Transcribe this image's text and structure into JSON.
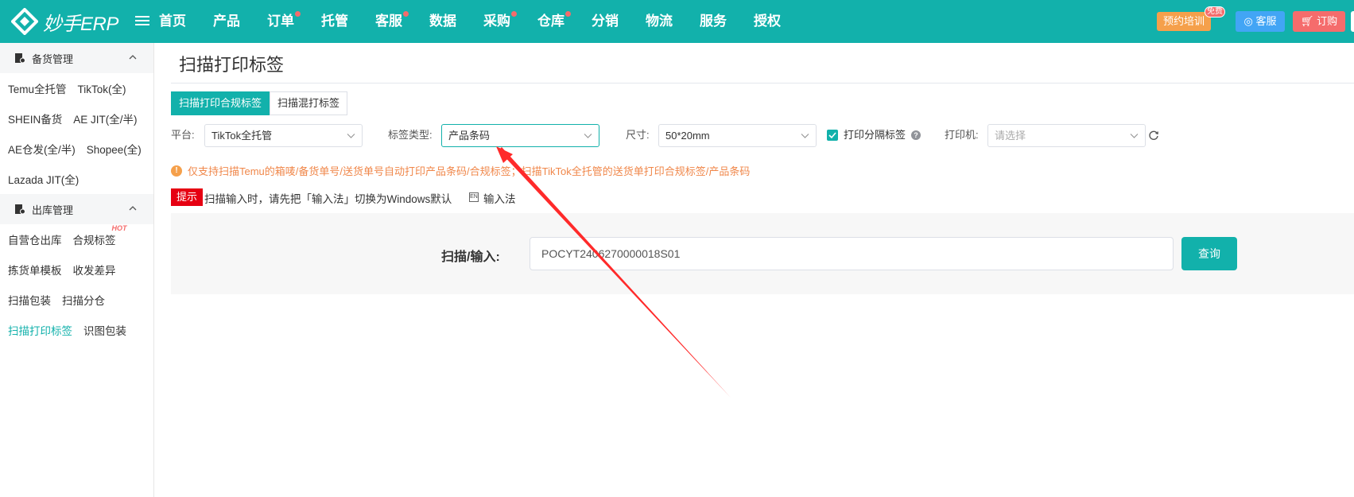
{
  "brand": {
    "logo_text": "妙手ERP",
    "color": "#12b1ab"
  },
  "nav": {
    "items": [
      {
        "label": "首页",
        "dot": false
      },
      {
        "label": "产品",
        "dot": false
      },
      {
        "label": "订单",
        "dot": true
      },
      {
        "label": "托管",
        "dot": false
      },
      {
        "label": "客服",
        "dot": true
      },
      {
        "label": "数据",
        "dot": false
      },
      {
        "label": "采购",
        "dot": true
      },
      {
        "label": "仓库",
        "dot": true
      },
      {
        "label": "分销",
        "dot": false
      },
      {
        "label": "物流",
        "dot": false
      },
      {
        "label": "服务",
        "dot": false
      },
      {
        "label": "授权",
        "dot": false
      }
    ],
    "training_label": "预约培训",
    "free_badge": "免费",
    "service_label": "客服",
    "order_label": "订购"
  },
  "sidebar": {
    "group1": {
      "label": "备货管理"
    },
    "group1_rows": [
      [
        "Temu全托管",
        "TikTok(全)"
      ],
      [
        "SHEIN备货",
        "AE JIT(全/半)"
      ],
      [
        "AE仓发(全/半)",
        "Shopee(全)"
      ],
      [
        "Lazada JIT(全)"
      ]
    ],
    "group2": {
      "label": "出库管理"
    },
    "group2_rows": [
      [
        "自营仓出库",
        "合规标签"
      ],
      [
        "拣货单模板",
        "收发差异"
      ],
      [
        "扫描包装",
        "扫描分仓"
      ],
      [
        "扫描打印标签",
        "识图包装"
      ]
    ],
    "hot_badge": "HOT"
  },
  "page": {
    "title": "扫描打印标签",
    "tabs": [
      "扫描打印合规标签",
      "扫描混打标签"
    ],
    "platform_label": "平台:",
    "platform_value": "TikTok全托管",
    "label_type_label": "标签类型:",
    "label_type_value": "产品条码",
    "size_label": "尺寸:",
    "size_value": "50*20mm",
    "print_divider_label": "打印分隔标签",
    "printer_label": "打印机:",
    "printer_placeholder": "请选择",
    "warning": "仅支持扫描Temu的箱唛/备货单号/送货单号自动打印产品条码/合规标签；扫描TikTok全托管的送货单打印合规标签/产品条码",
    "tip_badge": "提示",
    "tip_text": "扫描输入时，请先把「输入法」切换为Windows默认",
    "ime_label": "输入法",
    "scan_label": "扫描/输入:",
    "scan_value": "POCYT2406270000018S01",
    "query_label": "查询"
  }
}
